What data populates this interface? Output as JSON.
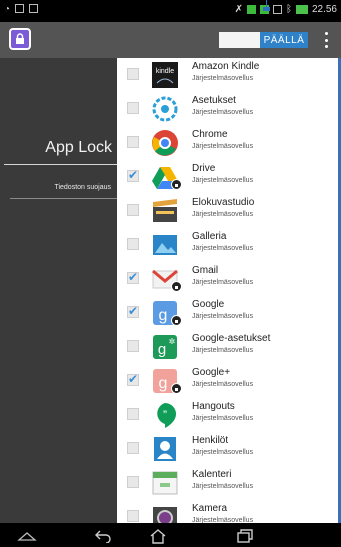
{
  "statusbar": {
    "left_icons": [
      "wifi-icon",
      "file-icon",
      "image-icon"
    ],
    "time": "22.56",
    "right_icons": [
      "signal-icon",
      "app-status-icon",
      "cell-icon",
      "screen-icon",
      "bluetooth-icon",
      "battery-icon"
    ]
  },
  "actionbar": {
    "toggle_label": "PÄÄLLÄ",
    "colors": {
      "toggle_on": "#2f82c8",
      "bar": "#545454",
      "app_icon": "#7b5bd6"
    }
  },
  "left_panel": {
    "title": "App Lock",
    "item": "Tiedoston suojaus"
  },
  "app_list": {
    "items": [
      {
        "name": "Amazon Kindle",
        "subtitle": "Järjestelmäsovellus",
        "checked": false,
        "locked": false,
        "icon": "kindle-icon"
      },
      {
        "name": "Asetukset",
        "subtitle": "Järjestelmäsovellus",
        "checked": false,
        "locked": false,
        "icon": "settings-icon"
      },
      {
        "name": "Chrome",
        "subtitle": "Järjestelmäsovellus",
        "checked": false,
        "locked": false,
        "icon": "chrome-icon"
      },
      {
        "name": "Drive",
        "subtitle": "Järjestelmäsovellus",
        "checked": true,
        "locked": true,
        "icon": "drive-icon"
      },
      {
        "name": "Elokuvastudio",
        "subtitle": "Järjestelmäsovellus",
        "checked": false,
        "locked": false,
        "icon": "movie-studio-icon"
      },
      {
        "name": "Galleria",
        "subtitle": "Järjestelmäsovellus",
        "checked": false,
        "locked": false,
        "icon": "gallery-icon"
      },
      {
        "name": "Gmail",
        "subtitle": "Järjestelmäsovellus",
        "checked": true,
        "locked": true,
        "icon": "gmail-icon"
      },
      {
        "name": "Google",
        "subtitle": "Järjestelmäsovellus",
        "checked": true,
        "locked": true,
        "icon": "google-search-icon"
      },
      {
        "name": "Google-asetukset",
        "subtitle": "Järjestelmäsovellus",
        "checked": false,
        "locked": false,
        "icon": "google-settings-icon"
      },
      {
        "name": "Google+",
        "subtitle": "Järjestelmäsovellus",
        "checked": true,
        "locked": true,
        "icon": "google-plus-icon"
      },
      {
        "name": "Hangouts",
        "subtitle": "Järjestelmäsovellus",
        "checked": false,
        "locked": false,
        "icon": "hangouts-icon"
      },
      {
        "name": "Henkilöt",
        "subtitle": "Järjestelmäsovellus",
        "checked": false,
        "locked": false,
        "icon": "people-icon"
      },
      {
        "name": "Kalenteri",
        "subtitle": "Järjestelmäsovellus",
        "checked": false,
        "locked": false,
        "icon": "calendar-icon"
      },
      {
        "name": "Kamera",
        "subtitle": "Järjestelmäsovellus",
        "checked": false,
        "locked": false,
        "icon": "camera-icon"
      }
    ]
  },
  "navbar": {
    "buttons": [
      "collapse-icon",
      "back-icon",
      "home-icon",
      "recent-apps-icon"
    ]
  }
}
